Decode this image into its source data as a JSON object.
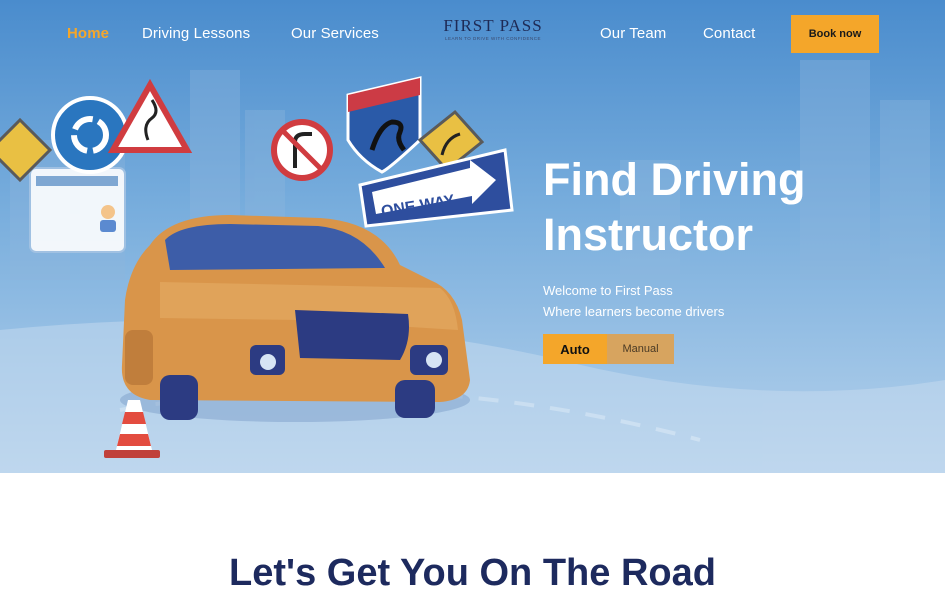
{
  "nav": {
    "items": [
      {
        "label": "Home",
        "active": true
      },
      {
        "label": "Driving Lessons"
      },
      {
        "label": "Our Services"
      },
      {
        "label": "Our Team"
      },
      {
        "label": "Contact"
      }
    ],
    "logo": {
      "text": "FIRST PASS",
      "tagline": "LEARN TO DRIVE WITH CONFIDENCE"
    },
    "cta_label": "Book now"
  },
  "hero": {
    "title": "Find Driving Instructor",
    "subtitle_line1": "Welcome to First Pass",
    "subtitle_line2": "Where learners become drivers",
    "buttons": {
      "auto": "Auto",
      "manual": "Manual"
    },
    "sign_text": "ONE WAY",
    "icons": [
      "roundabout-sign-icon",
      "curve-warning-sign-icon",
      "no-right-turn-sign-icon",
      "kangaroo-crossing-sign-icon",
      "curve-arrow-sign-icon",
      "one-way-sign-icon",
      "car-icon",
      "traffic-cone-icon",
      "license-card-icon"
    ]
  },
  "section": {
    "title": "Let's Get You On The Road"
  },
  "colors": {
    "accent": "#f4a62a",
    "navy": "#1d2a5e",
    "hero_blue": "#5b9ad6",
    "manual_button": "#d7a45f"
  }
}
